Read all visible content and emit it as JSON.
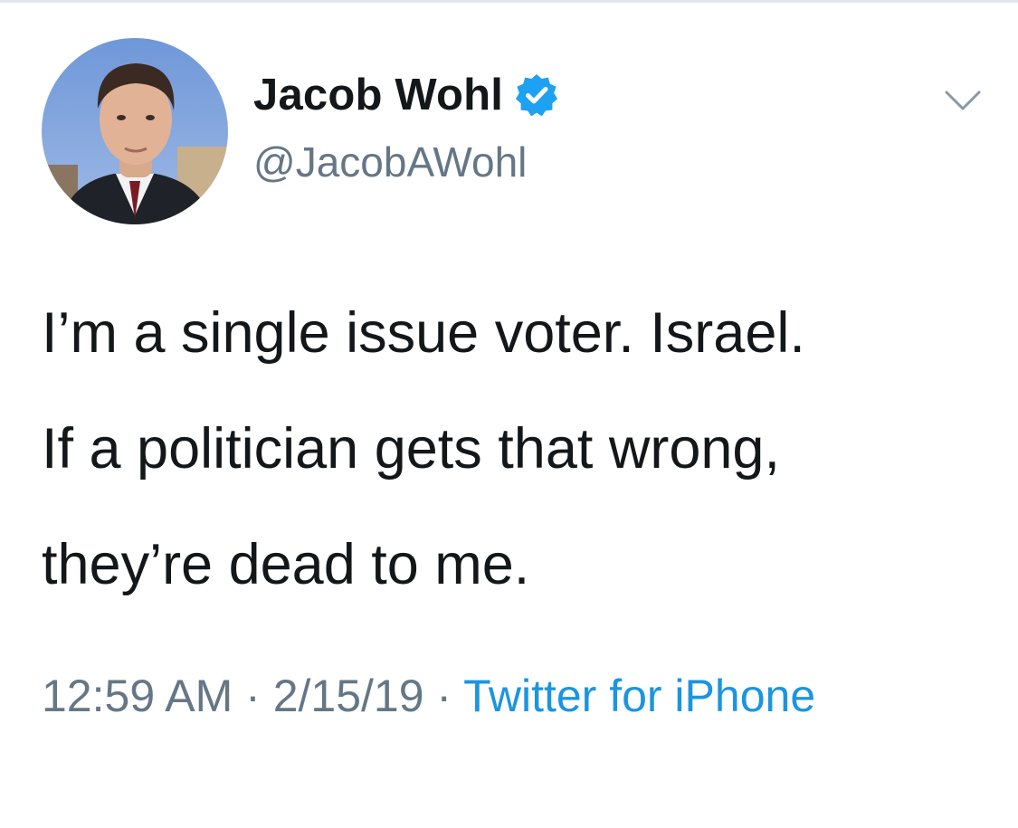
{
  "tweet": {
    "author": {
      "display_name": "Jacob Wohl",
      "handle": "@JacobAWohl",
      "verified": true,
      "avatar_icon": "profile-photo"
    },
    "text_lines": [
      "I’m a single issue voter. Israel.",
      "If a politician gets that wrong,",
      "they’re dead to me."
    ],
    "time": "12:59 AM",
    "separator": " · ",
    "date": "2/15/19",
    "source": "Twitter for iPhone",
    "more_icon": "chevron-down-icon"
  },
  "colors": {
    "text": "#14171a",
    "secondary": "#657786",
    "link": "#1b95e0",
    "verified": "#1da1f2"
  }
}
